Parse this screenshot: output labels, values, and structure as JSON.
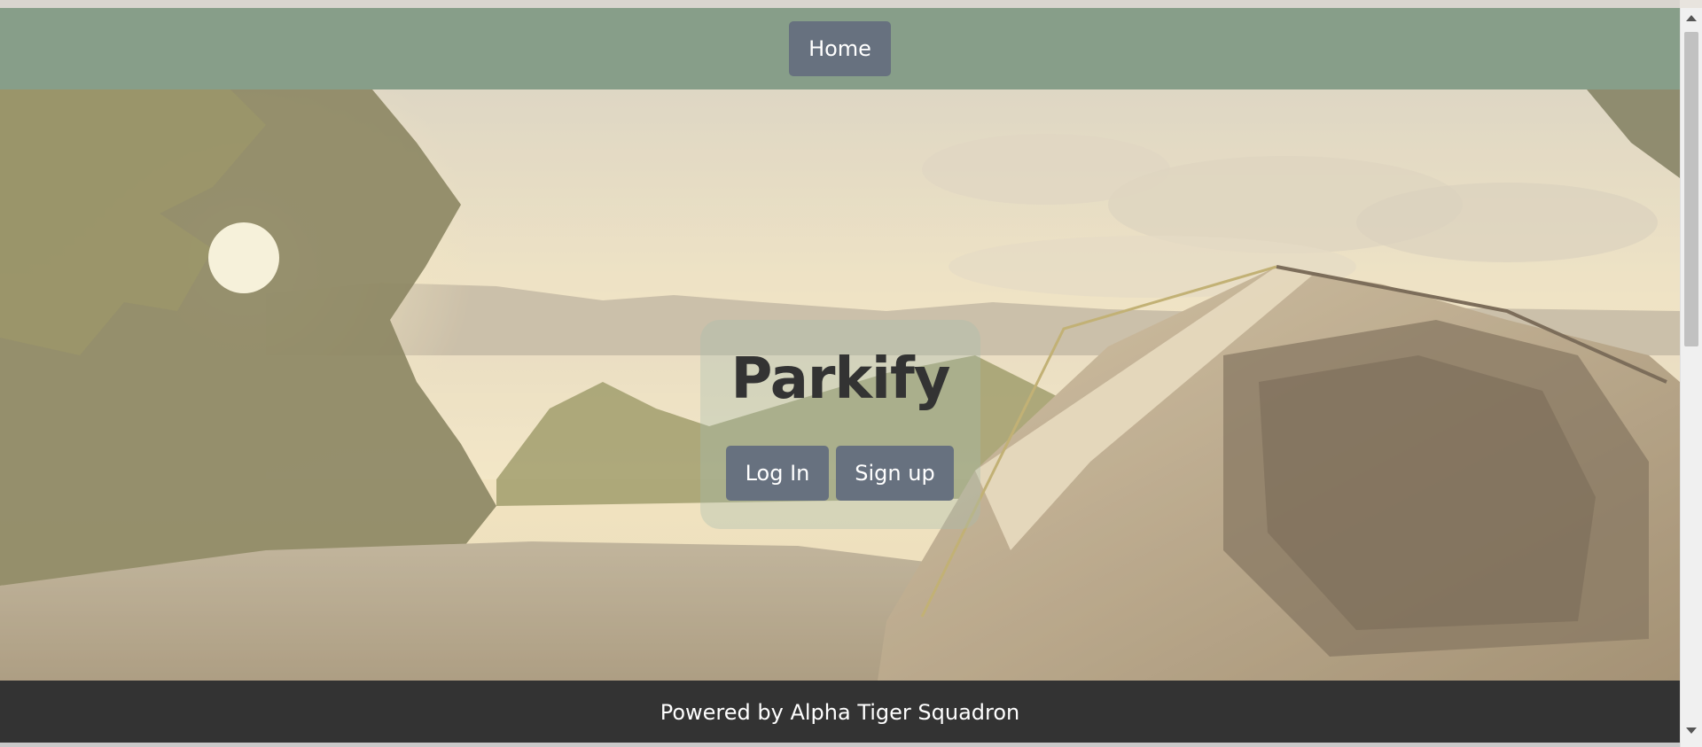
{
  "navbar": {
    "home_label": "Home",
    "background_color": "#879e89"
  },
  "hero": {
    "title": "Parkify",
    "login_label": "Log In",
    "signup_label": "Sign up",
    "button_color": "#67717f",
    "image_description_icon": "camping-tent-sunset-image"
  },
  "footer": {
    "text": "Powered by Alpha Tiger Squadron",
    "background_color": "#333333"
  }
}
